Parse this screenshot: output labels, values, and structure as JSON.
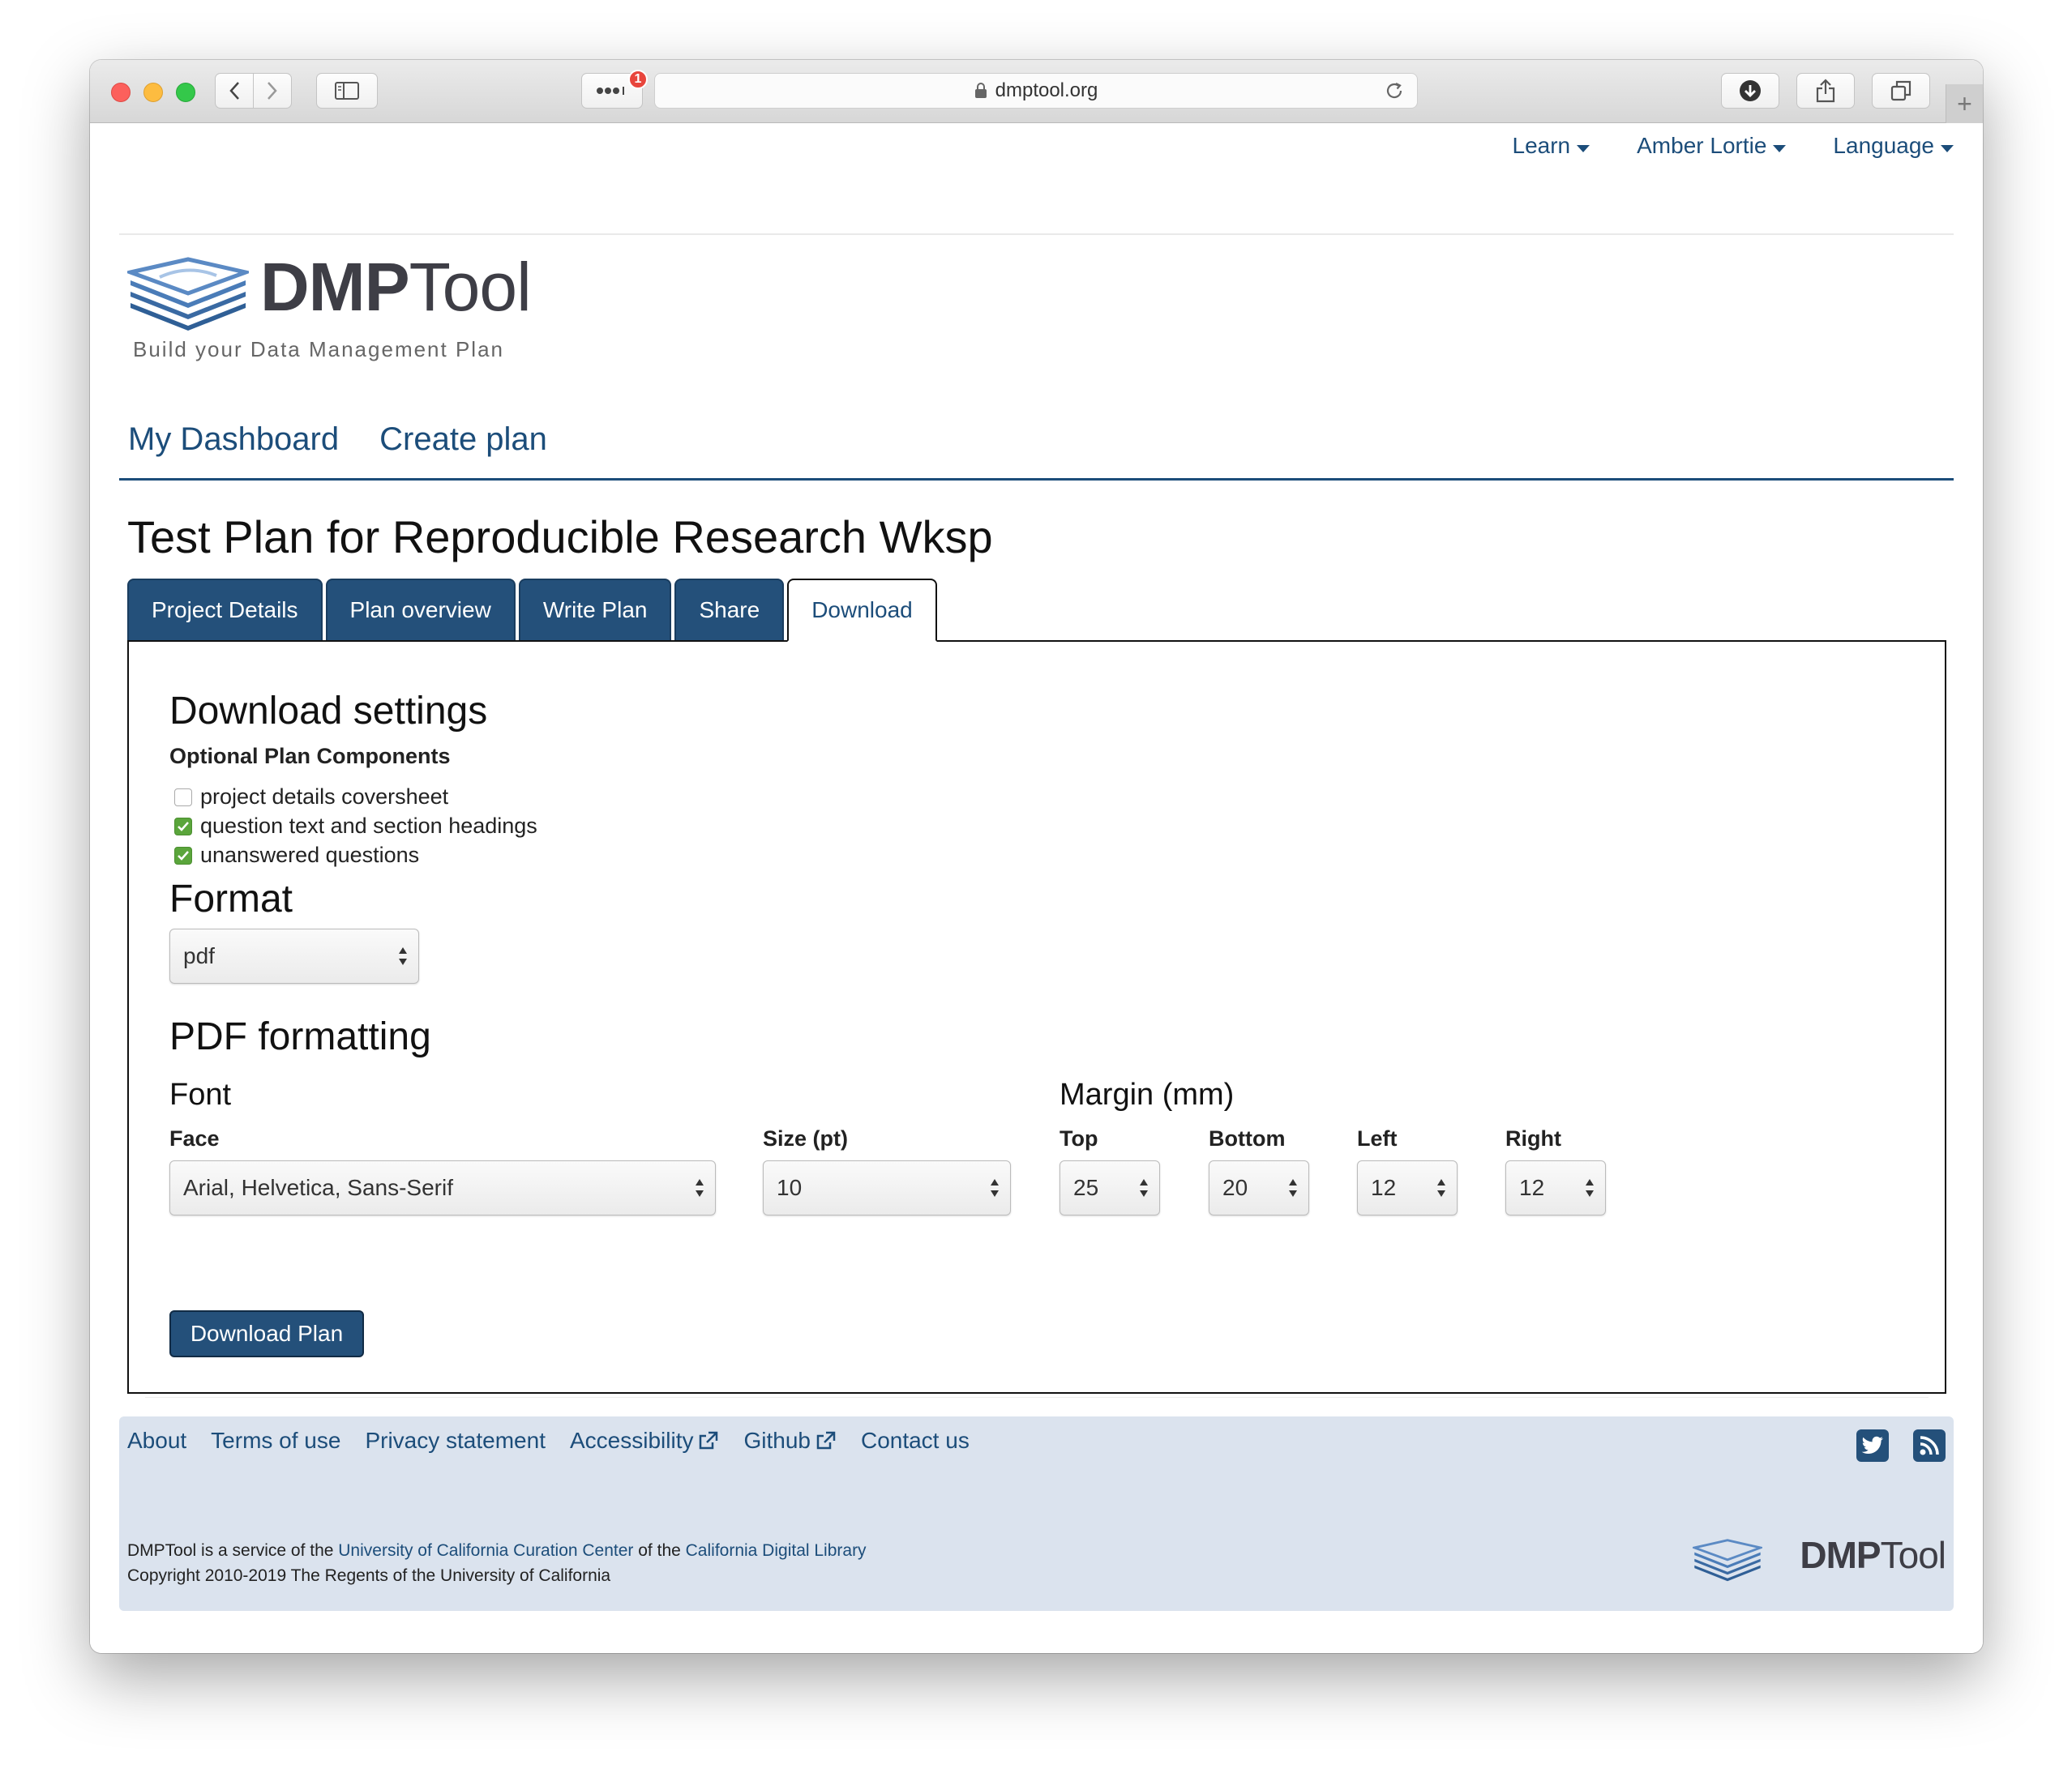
{
  "browser": {
    "url": "dmptool.org",
    "badge_count": "1"
  },
  "topnav": {
    "learn": "Learn",
    "user": "Amber Lortie",
    "language": "Language"
  },
  "logo": {
    "brand_bold": "DMP",
    "brand_light": "Tool",
    "tagline": "Build your Data Management Plan"
  },
  "mainnav": {
    "dashboard": "My Dashboard",
    "create_plan": "Create plan"
  },
  "plan": {
    "title": "Test Plan for Reproducible Research Wksp"
  },
  "tabs": [
    {
      "label": "Project Details",
      "active": false
    },
    {
      "label": "Plan overview",
      "active": false
    },
    {
      "label": "Write Plan",
      "active": false
    },
    {
      "label": "Share",
      "active": false
    },
    {
      "label": "Download",
      "active": true
    }
  ],
  "download": {
    "heading": "Download settings",
    "optional_heading": "Optional Plan Components",
    "components": [
      {
        "label": "project details coversheet",
        "checked": false
      },
      {
        "label": "question text and section headings",
        "checked": true
      },
      {
        "label": "unanswered questions",
        "checked": true
      }
    ],
    "format_heading": "Format",
    "format_value": "pdf",
    "pdf_heading": "PDF formatting",
    "font_heading": "Font",
    "face_label": "Face",
    "face_value": "Arial, Helvetica, Sans-Serif",
    "size_label": "Size (pt)",
    "size_value": "10",
    "margin_heading": "Margin (mm)",
    "margins": {
      "top_label": "Top",
      "top_value": "25",
      "bottom_label": "Bottom",
      "bottom_value": "20",
      "left_label": "Left",
      "left_value": "12",
      "right_label": "Right",
      "right_value": "12"
    },
    "button": "Download Plan"
  },
  "footer": {
    "links": [
      "About",
      "Terms of use",
      "Privacy statement",
      "Accessibility",
      "Github",
      "Contact us"
    ],
    "service_prefix": "DMPTool is a service of the ",
    "ucc": "University of California Curation Center",
    "service_mid": " of the ",
    "cdl": "California Digital Library",
    "copyright": "Copyright 2010-2019 The Regents of the University of California",
    "logo_bold": "DMP",
    "logo_light": "Tool"
  },
  "colors": {
    "brand_blue": "#24507a",
    "link_blue": "#1c4d7a",
    "footer_bg": "#dbe3ee",
    "check_green": "#5aa53b"
  }
}
